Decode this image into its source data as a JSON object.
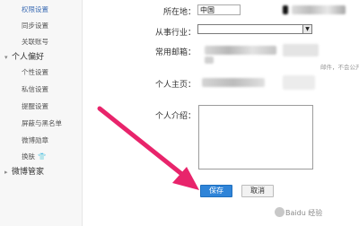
{
  "sidebar": {
    "items": [
      {
        "label": "权限设置",
        "type": "sub",
        "active": true
      },
      {
        "label": "同步设置",
        "type": "sub"
      },
      {
        "label": "关联账号",
        "type": "sub"
      },
      {
        "label": "个人偏好",
        "type": "section"
      },
      {
        "label": "个性设置",
        "type": "sub"
      },
      {
        "label": "私信设置",
        "type": "sub"
      },
      {
        "label": "提醒设置",
        "type": "sub"
      },
      {
        "label": "屏蔽与黑名单",
        "type": "sub"
      },
      {
        "label": "微博勋章",
        "type": "sub"
      },
      {
        "label": "换肤",
        "type": "sub"
      },
      {
        "label": "微博管家",
        "type": "section"
      }
    ]
  },
  "form": {
    "location_label": "所在地：",
    "location_value": "中国",
    "industry_label": "从事行业：",
    "email_label": "常用邮箱：",
    "email_hint": "邮件，不会公开显",
    "homepage_label": "个人主页：",
    "bio_label": "个人介绍：",
    "save_label": "保存",
    "cancel_label": "取消"
  },
  "watermark": {
    "text": "Baidu 经验"
  },
  "colors": {
    "arrow": "#e8246b",
    "save_button": "#2f84d8",
    "active_nav": "#3d6db4"
  }
}
